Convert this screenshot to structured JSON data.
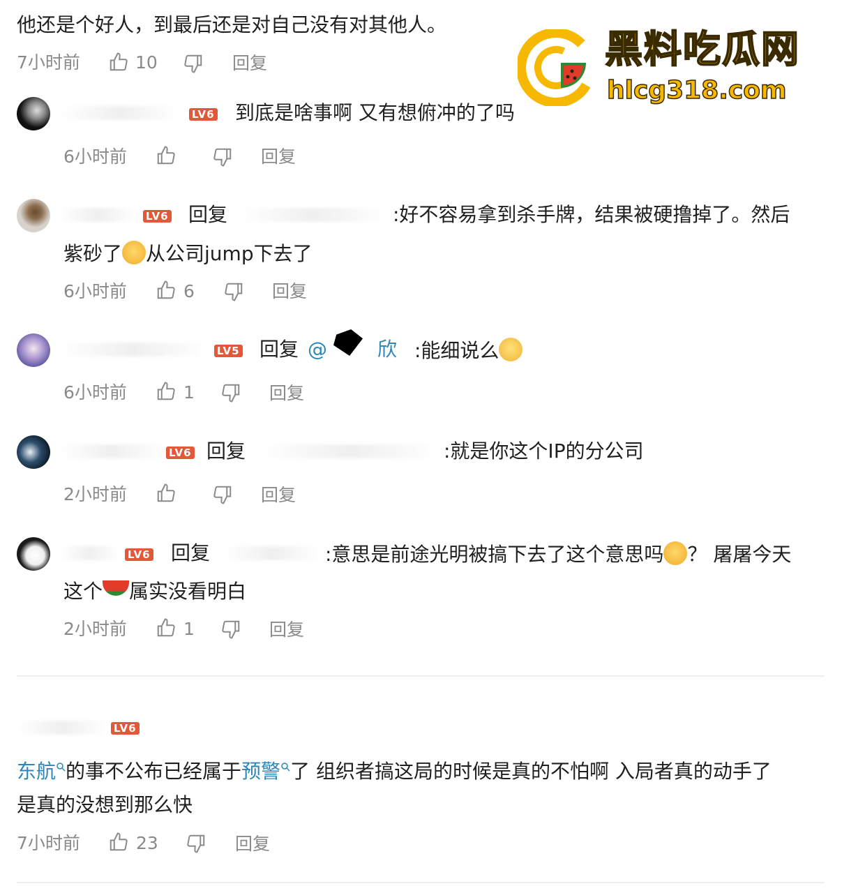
{
  "watermark": {
    "brand": "黑料吃瓜网",
    "url": "hlcg318.com",
    "colors": {
      "yellow": "#f6b800",
      "green": "#2f8a35",
      "red": "#e23b2a"
    }
  },
  "icons": {
    "like": "thumbs-up-icon",
    "dislike": "thumbs-down-icon",
    "search": "search-icon"
  },
  "comments": [
    {
      "text": "他还是个好人，到最后还是对自己没有对其他人。",
      "time": "7小时前",
      "likes": "10",
      "reply_label": "回复"
    },
    {
      "level": "LV6",
      "text": "到底是啥事啊 又有想俯冲的了吗",
      "time": "6小时前",
      "likes": "",
      "reply_label": "回复"
    },
    {
      "level": "LV6",
      "reply_word": "回复",
      "text_a": ":好不容易拿到杀手牌，结果被硬撸掉了。然后",
      "text_b": "紫砂了",
      "text_c": "从公司jump下去了",
      "time": "6小时前",
      "likes": "6",
      "reply_label": "回复"
    },
    {
      "level": "LV5",
      "reply_word": "回复",
      "mention_a": "@",
      "mention_b": "欣",
      "text": ":能细说么",
      "time": "6小时前",
      "likes": "1",
      "reply_label": "回复"
    },
    {
      "level": "LV6",
      "reply_word": "回复",
      "text": ":就是你这个IP的分公司",
      "time": "2小时前",
      "likes": "",
      "reply_label": "回复"
    },
    {
      "level": "LV6",
      "reply_word": "回复",
      "text_a": ":意思是前途光明被搞下去了这个意思吗",
      "text_b": "？ 屠屠今天",
      "text_c": "这个",
      "text_d": "属实没看明白",
      "time": "2小时前",
      "likes": "1",
      "reply_label": "回复"
    },
    {
      "level": "LV6",
      "link1": "东航",
      "mid1": "的事不公布已经属于",
      "link2": "预警",
      "rest": "了 组织者搞这局的时候是真的不怕啊 入局者真的动手了",
      "line2": "是真的没想到那么快",
      "time": "7小时前",
      "likes": "23",
      "reply_label": "回复"
    }
  ]
}
